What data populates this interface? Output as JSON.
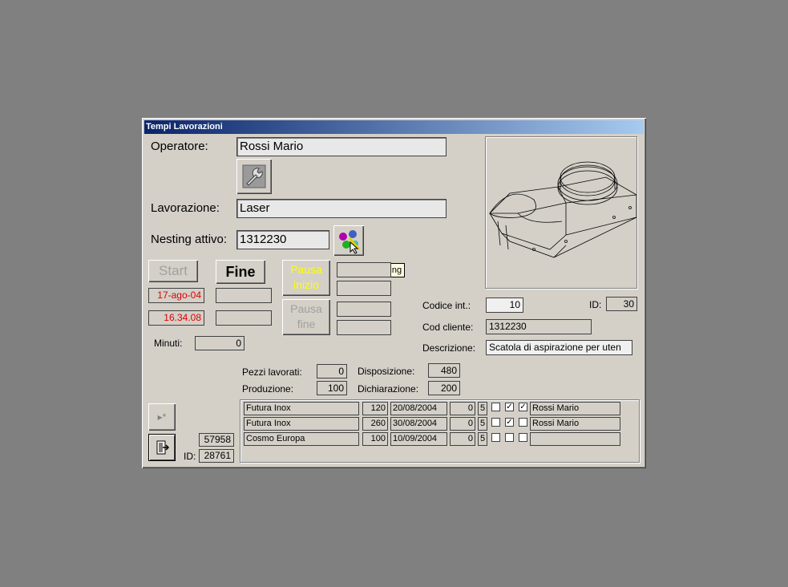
{
  "window": {
    "title": "Tempi Lavorazioni"
  },
  "operatore": {
    "label": "Operatore:",
    "value": "Rossi Mario"
  },
  "lavorazione": {
    "label": "Lavorazione:",
    "value": "Laser"
  },
  "nesting": {
    "label": "Nesting attivo:",
    "value": "1312230",
    "tooltip": "Apri nesting"
  },
  "buttons": {
    "start": "Start",
    "fine": "Fine",
    "pausa_inizio": "Pausa inizio",
    "pausa_fine": "Pausa fine"
  },
  "times": {
    "date": "17-ago-04",
    "time": "16.34.08"
  },
  "minuti": {
    "label": "Minuti:",
    "value": "0"
  },
  "codice_int": {
    "label": "Codice  int.:",
    "value": "10"
  },
  "id_top": {
    "label": "ID:",
    "value": "30"
  },
  "cod_cliente": {
    "label": "Cod cliente:",
    "value": "1312230"
  },
  "descrizione": {
    "label": "Descrizione:",
    "value": "Scatola di aspirazione per uten"
  },
  "pezzi_lavorati": {
    "label": "Pezzi lavorati:",
    "value": "0"
  },
  "produzione": {
    "label": "Produzione:",
    "value": "100"
  },
  "disposizione": {
    "label": "Disposizione:",
    "value": "480"
  },
  "dichiarazione": {
    "label": "Dichiarazione:",
    "value": "200"
  },
  "footer": {
    "record": "57958",
    "id_label": "ID:",
    "id_value": "28761"
  },
  "rows": [
    {
      "cliente": "Futura Inox",
      "qty": "120",
      "date": "20/08/2004",
      "n1": "0",
      "n2": "5",
      "c1": false,
      "c2": true,
      "c3": true,
      "operatore": "Rossi Mario"
    },
    {
      "cliente": "Futura Inox",
      "qty": "260",
      "date": "30/08/2004",
      "n1": "0",
      "n2": "5",
      "c1": false,
      "c2": true,
      "c3": false,
      "operatore": "Rossi Mario"
    },
    {
      "cliente": "Cosmo Europa",
      "qty": "100",
      "date": "10/09/2004",
      "n1": "0",
      "n2": "5",
      "c1": false,
      "c2": false,
      "c3": false,
      "operatore": ""
    }
  ],
  "colors": {
    "accent_yellow": "#ffff00",
    "red_text": "#e00000",
    "title_start": "#0a246a",
    "title_end": "#a6caf0"
  }
}
